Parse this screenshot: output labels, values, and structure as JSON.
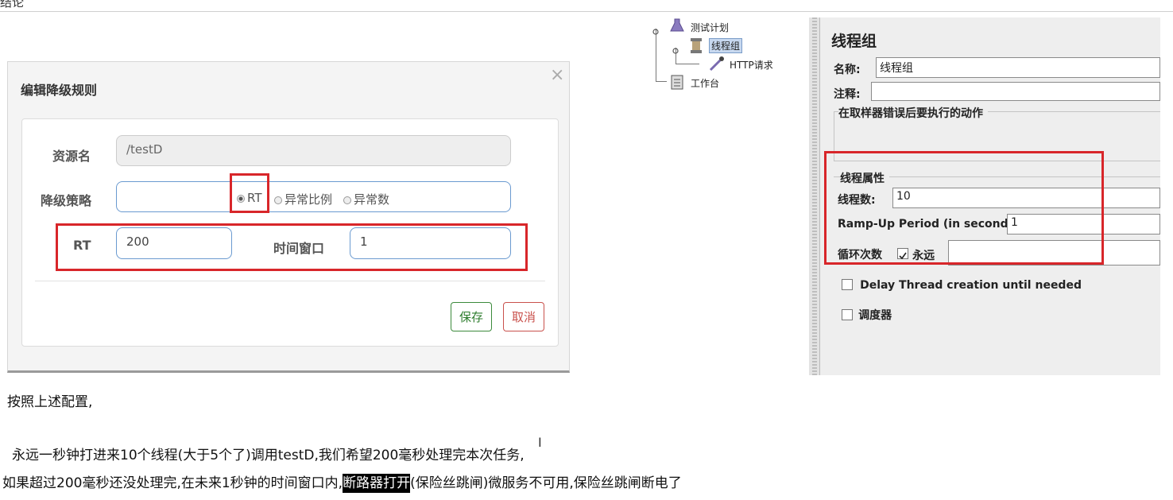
{
  "top": {
    "heading": "结论"
  },
  "modal": {
    "title": "编辑降级规则",
    "close_glyph": "×",
    "resource_label": "资源名",
    "resource_value": "/testD",
    "strategy_label": "降级策略",
    "strategy_options": [
      "RT",
      "异常比例",
      "异常数"
    ],
    "rt_label": "RT",
    "rt_value": "200",
    "window_label": "时间窗口",
    "window_value": "1",
    "save_label": "保存",
    "cancel_label": "取消"
  },
  "tree": {
    "nodes": [
      {
        "label": "测试计划",
        "icon": "flask-icon"
      },
      {
        "label": "线程组",
        "icon": "spool-icon"
      },
      {
        "label": "HTTP请求",
        "icon": "pipette-icon"
      },
      {
        "label": "工作台",
        "icon": "clipboard-icon"
      }
    ]
  },
  "jmeter": {
    "title": "线程组",
    "name_label": "名称:",
    "name_value": "线程组",
    "comment_label": "注释:",
    "error_action_label": "在取样器错误后要执行的动作",
    "thread_props_label": "线程属性",
    "threads_label": "线程数:",
    "threads_value": "10",
    "rampup_label": "Ramp-Up Period (in seconds):",
    "rampup_value": "1",
    "loop_label": "循环次数",
    "forever_label": "永远",
    "delay_label": "Delay Thread creation until needed",
    "scheduler_label": "调度器"
  },
  "text": {
    "line1": "按照上述配置,",
    "line2": "永远一秒钟打进来10个线程(大于5个了)调用testD,我们希望200毫秒处理完本次任务,",
    "line3_pre": "如果超过200毫秒还没处理完,在未来1秒钟的时间窗口内,",
    "line3_highlight": "断路器打开",
    "line3_post": "(保险丝跳闸)微服务不可用,保险丝跳闸断电了"
  },
  "colors": {
    "annotation_red": "#d8262a",
    "field_border": "#6a9ad0",
    "save_green": "#2e7d2e",
    "cancel_red": "#c9514c"
  }
}
